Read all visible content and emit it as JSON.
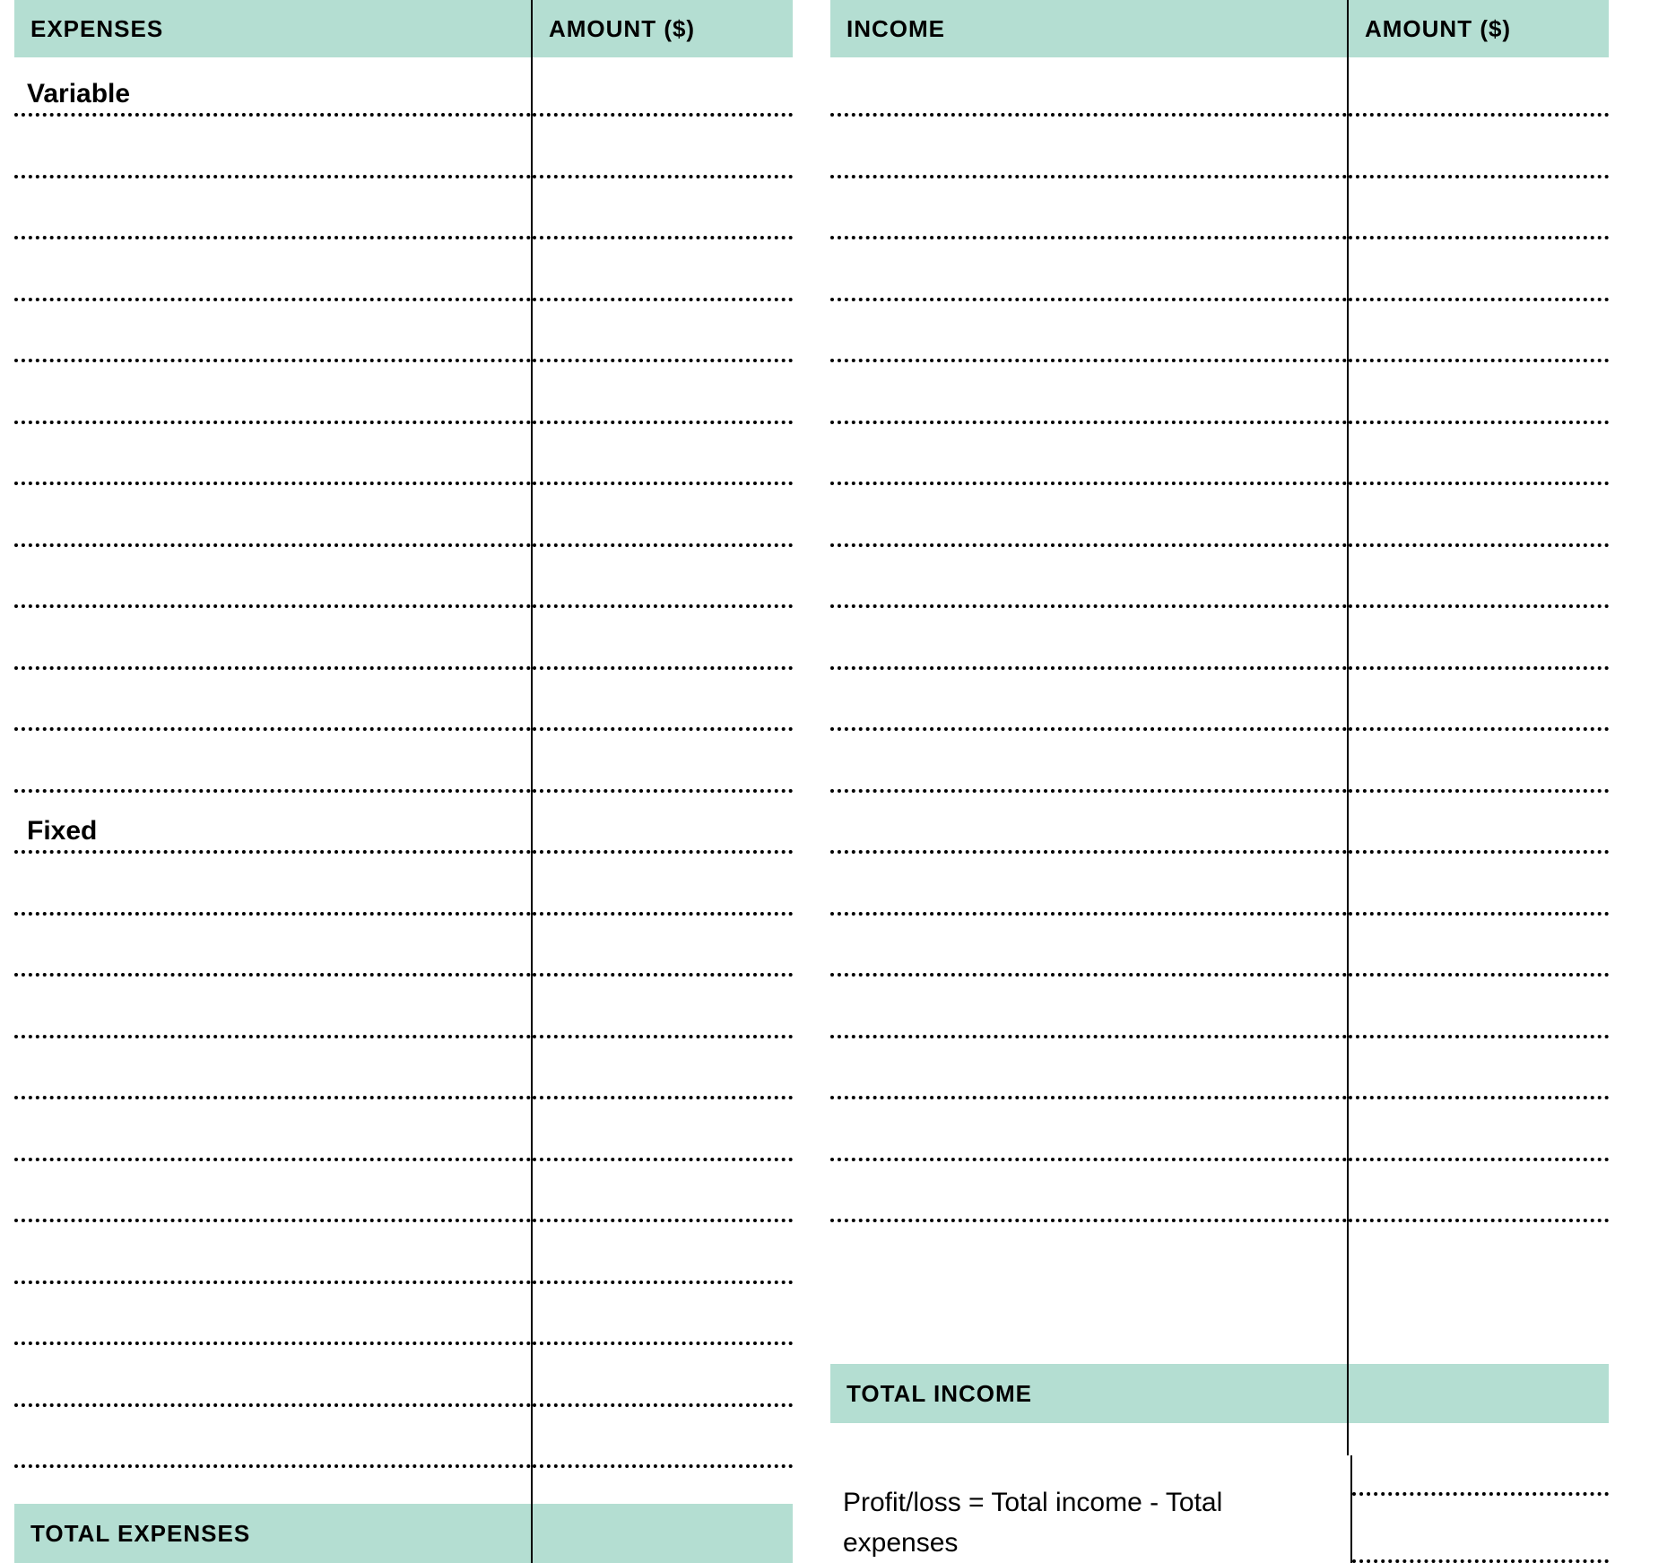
{
  "expenses": {
    "header_label": "EXPENSES",
    "amount_label": "AMOUNT ($)",
    "section_variable": "Variable",
    "section_fixed": "Fixed",
    "total_label": "TOTAL EXPENSES"
  },
  "income": {
    "header_label": "INCOME",
    "amount_label": "AMOUNT ($)",
    "total_label": "TOTAL INCOME"
  },
  "formula": "Profit/loss = Total income - Total expenses"
}
